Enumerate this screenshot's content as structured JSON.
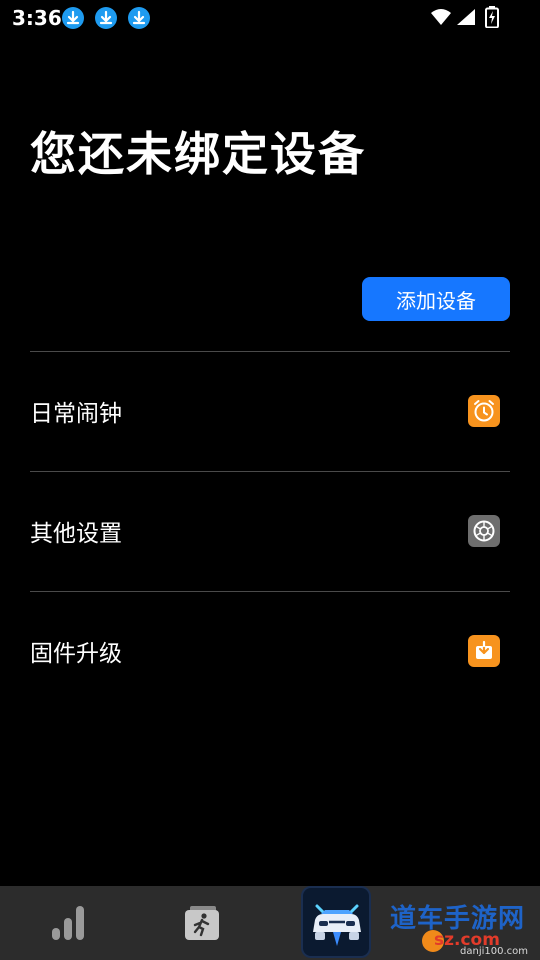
{
  "status_bar": {
    "time": "3:36",
    "notification_icons": [
      "download-icon",
      "download-icon",
      "download-icon"
    ],
    "right_icons": [
      "wifi-icon",
      "signal-icon",
      "battery-charging-icon"
    ]
  },
  "page_title": "您还未绑定设备",
  "add_device_button": "添加设备",
  "menu": [
    {
      "label": "日常闹钟",
      "icon": "alarm-clock-icon",
      "icon_color": "#f7931e"
    },
    {
      "label": "其他设置",
      "icon": "settings-gear-icon",
      "icon_color": "#6e6e6e"
    },
    {
      "label": "固件升级",
      "icon": "firmware-download-icon",
      "icon_color": "#f7931e"
    }
  ],
  "bottom_nav": {
    "tabs": [
      "stats-bars-icon",
      "running-card-icon",
      "car-app-icon"
    ]
  },
  "watermark": {
    "main": "道车手游网",
    "site": "sz.com",
    "small": "danji100.com"
  },
  "colors": {
    "background": "#000000",
    "accent": "#1677ff",
    "divider": "#4a4a4a",
    "nav_bg": "#2c2c2c"
  }
}
